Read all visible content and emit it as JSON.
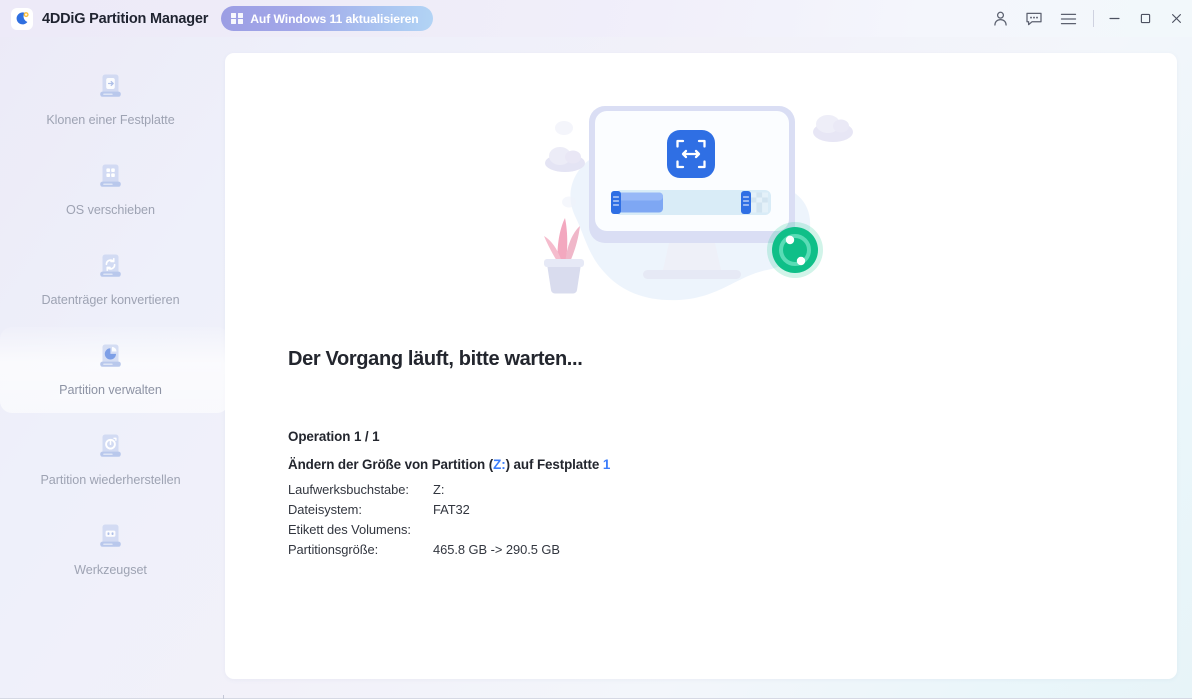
{
  "window": {
    "app_title": "4DDiG Partition Manager",
    "logo_icon": "4ddig-logo-icon",
    "update_button": {
      "label": "Auf Windows 11 aktualisieren",
      "icon": "windows-logo-icon"
    },
    "controls": [
      {
        "name": "account-icon",
        "label": "Konto"
      },
      {
        "name": "feedback-icon",
        "label": "Feedback"
      },
      {
        "name": "menu-icon",
        "label": "Menü"
      },
      {
        "name": "minimize-icon",
        "label": "Minimieren"
      },
      {
        "name": "maximize-icon",
        "label": "Maximieren"
      },
      {
        "name": "close-icon",
        "label": "Schließen"
      }
    ]
  },
  "sidebar": {
    "items": [
      {
        "label": "Klonen einer Festplatte",
        "icon": "clone-disk-icon",
        "active": false
      },
      {
        "label": "OS verschieben",
        "icon": "move-os-icon",
        "active": false
      },
      {
        "label": "Datenträger konvertieren",
        "icon": "convert-disk-icon",
        "active": false
      },
      {
        "label": "Partition verwalten",
        "icon": "manage-partition-icon",
        "active": true
      },
      {
        "label": "Partition wiederherstellen",
        "icon": "recover-partition-icon",
        "active": false
      },
      {
        "label": "Werkzeugset",
        "icon": "toolkit-icon",
        "active": false
      }
    ]
  },
  "main": {
    "illustration": {
      "name": "resize-partition-illustration",
      "monitor_icon": "resize-arrows-icon",
      "progress_icon": "sync-progress-icon",
      "plant_icon": "potted-plant-icon",
      "cloud_icon": "cloud-icon"
    },
    "headline": "Der Vorgang läuft, bitte warten...",
    "operation_counter": "Operation 1 / 1",
    "operation_title": {
      "prefix": "Ändern der Größe von Partition (",
      "drive": "Z:",
      "middle": ") auf Festplatte ",
      "disk": "1"
    },
    "details": [
      {
        "key": "Laufwerksbuchstabe:",
        "value": "Z:"
      },
      {
        "key": "Dateisystem:",
        "value": "FAT32"
      },
      {
        "key": "Etikett des Volumens:",
        "value": ""
      },
      {
        "key": "Partitionsgröße:",
        "value": "465.8 GB -> 290.5 GB"
      }
    ]
  },
  "colors": {
    "accent_blue": "#3c7dfa",
    "icon_blue": "#b9c6ef",
    "progress_green": "#12c08a",
    "text_dark": "#23262e",
    "text_muted": "#9ea3b3"
  }
}
